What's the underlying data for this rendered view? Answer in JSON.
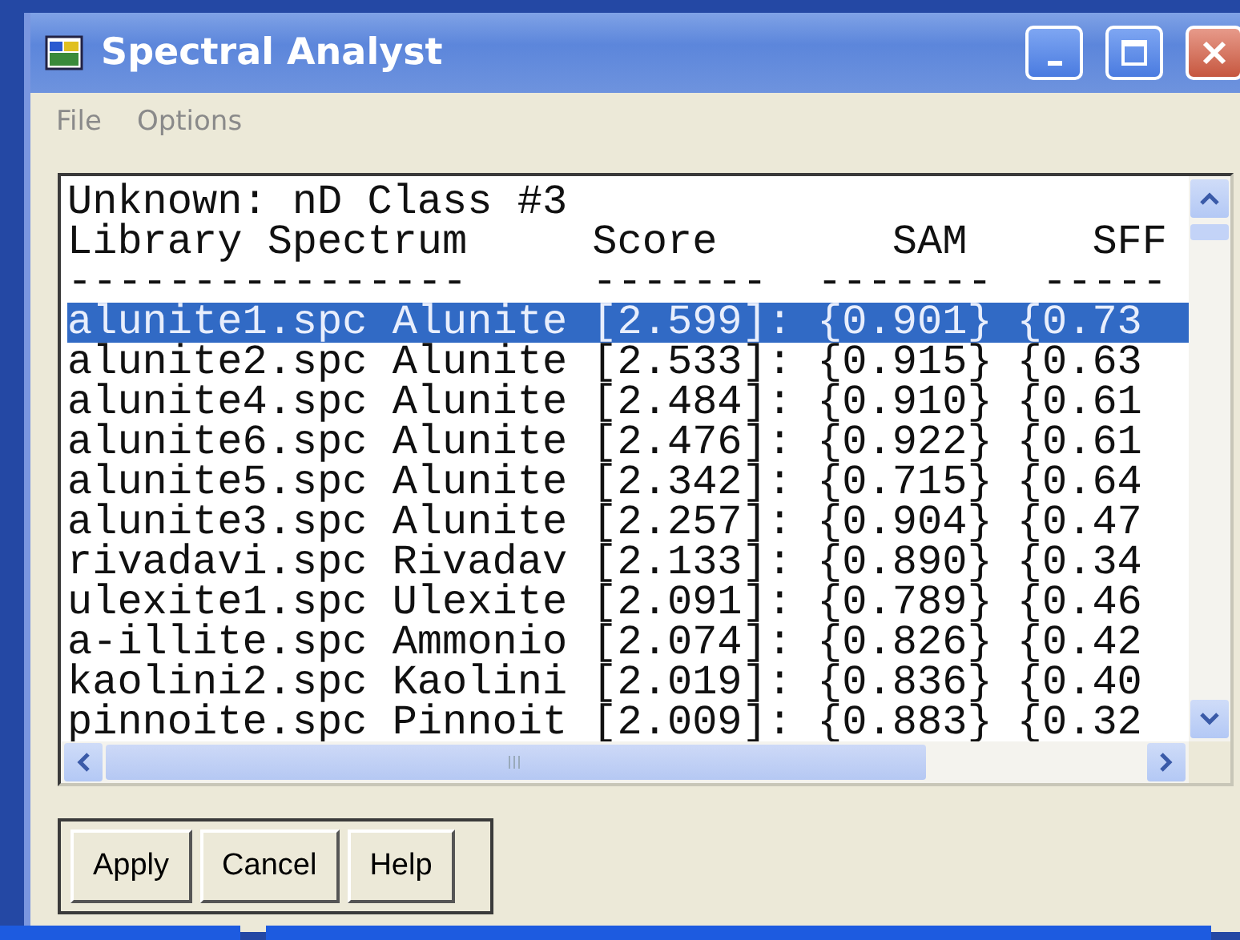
{
  "window": {
    "title": "Spectral Analyst"
  },
  "menu": [
    "File",
    "Options"
  ],
  "listing": {
    "caption": "Unknown: nD Class #3",
    "header": "Library Spectrum     Score       SAM     SFF",
    "rule": "----------------     -------  -------  -----",
    "rows": [
      {
        "text": "alunite1.spc Alunite [2.599]: {0.901} {0.73",
        "selected": true
      },
      {
        "text": "alunite2.spc Alunite [2.533]: {0.915} {0.63",
        "selected": false
      },
      {
        "text": "alunite4.spc Alunite [2.484]: {0.910} {0.61",
        "selected": false
      },
      {
        "text": "alunite6.spc Alunite [2.476]: {0.922} {0.61",
        "selected": false
      },
      {
        "text": "alunite5.spc Alunite [2.342]: {0.715} {0.64",
        "selected": false
      },
      {
        "text": "alunite3.spc Alunite [2.257]: {0.904} {0.47",
        "selected": false
      },
      {
        "text": "rivadavi.spc Rivadav [2.133]: {0.890} {0.34",
        "selected": false
      },
      {
        "text": "ulexite1.spc Ulexite [2.091]: {0.789} {0.46",
        "selected": false
      },
      {
        "text": "a-illite.spc Ammonio [2.074]: {0.826} {0.42",
        "selected": false
      },
      {
        "text": "kaolini2.spc Kaolini [2.019]: {0.836} {0.40",
        "selected": false
      },
      {
        "text": "pinnoite.spc Pinnoit [2.009]: {0.883} {0.32",
        "selected": false
      }
    ]
  },
  "buttons": [
    "Apply",
    "Cancel",
    "Help"
  ]
}
